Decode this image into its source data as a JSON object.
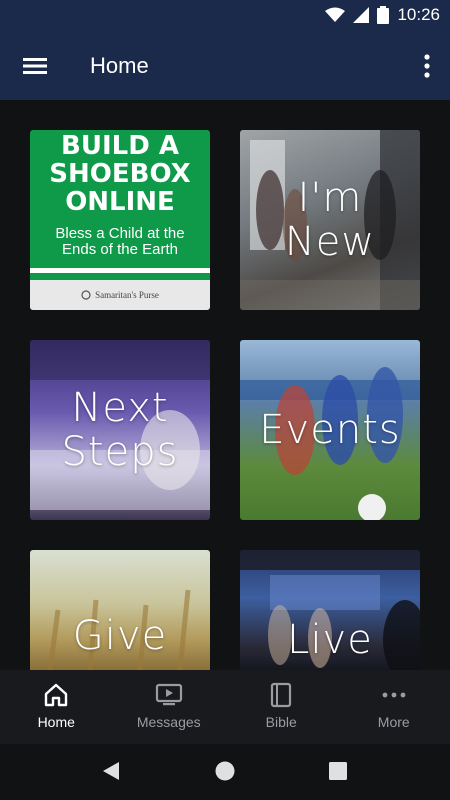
{
  "status_bar": {
    "time": "10:26"
  },
  "app_bar": {
    "title": "Home"
  },
  "tiles": [
    {
      "label": "",
      "headline": "BUILD A\nSHOEBOX\nONLINE",
      "subtitle": "Bless a Child at the\nEnds of the Earth",
      "logo_text": "Samaritan's Purse"
    },
    {
      "label": "I'm\nNew"
    },
    {
      "label": "Next\nSteps"
    },
    {
      "label": "Events"
    },
    {
      "label": "Give"
    },
    {
      "label": "Live"
    }
  ],
  "bottom_nav": {
    "items": [
      {
        "label": "Home",
        "icon": "home-icon",
        "active": true
      },
      {
        "label": "Messages",
        "icon": "tv-icon"
      },
      {
        "label": "Bible",
        "icon": "book-icon"
      },
      {
        "label": "More",
        "icon": "more-horizontal-icon"
      }
    ]
  },
  "colors": {
    "app_bar": "#1b2a4a",
    "background": "#111214",
    "shoebox_green": "#0f9a4a"
  }
}
